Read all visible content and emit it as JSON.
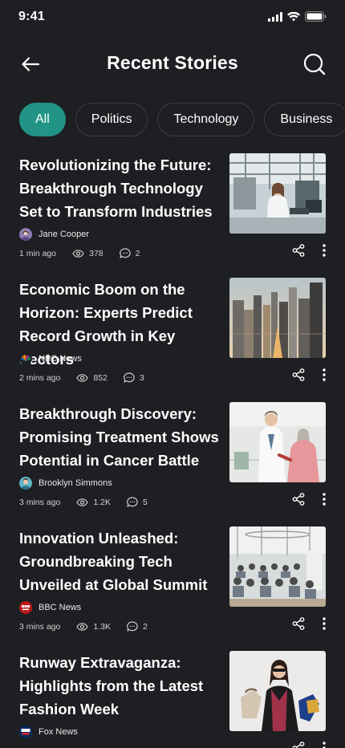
{
  "status": {
    "time": "9:41"
  },
  "header": {
    "title": "Recent Stories"
  },
  "chips": [
    "All",
    "Politics",
    "Technology",
    "Business"
  ],
  "articles": [
    {
      "title": "Revolutionizing the Future: Breakthrough Technology Set to Transform Industries",
      "source": "Jane Cooper",
      "time": "1 min ago",
      "views": "378",
      "comments": "2",
      "image_icon": "lab-photo"
    },
    {
      "title": "Economic Boom on the Horizon: Experts Predict Record Growth in Key Sectors",
      "source": "NBC News",
      "time": "2 mins ago",
      "views": "852",
      "comments": "3",
      "image_icon": "city-photo"
    },
    {
      "title": "Breakthrough Discovery: Promising Treatment Shows Potential in Cancer Battle",
      "source": "Brooklyn Simmons",
      "time": "3 mins ago",
      "views": "1.2K",
      "comments": "5",
      "image_icon": "doctor-photo"
    },
    {
      "title": "Innovation Unleashed: Groundbreaking Tech Unveiled at Global Summit",
      "source": "BBC News",
      "time": "3 mins ago",
      "views": "1.3K",
      "comments": "2",
      "image_icon": "conference-photo"
    },
    {
      "title": "Runway Extravaganza: Highlights from the Latest Fashion Week",
      "source": "Fox News",
      "time": "",
      "views": "",
      "comments": "",
      "image_icon": "fashion-photo"
    }
  ],
  "colors": {
    "background": "#1d1f22",
    "accent": "#229486",
    "chip_border": "#3b3e43"
  }
}
